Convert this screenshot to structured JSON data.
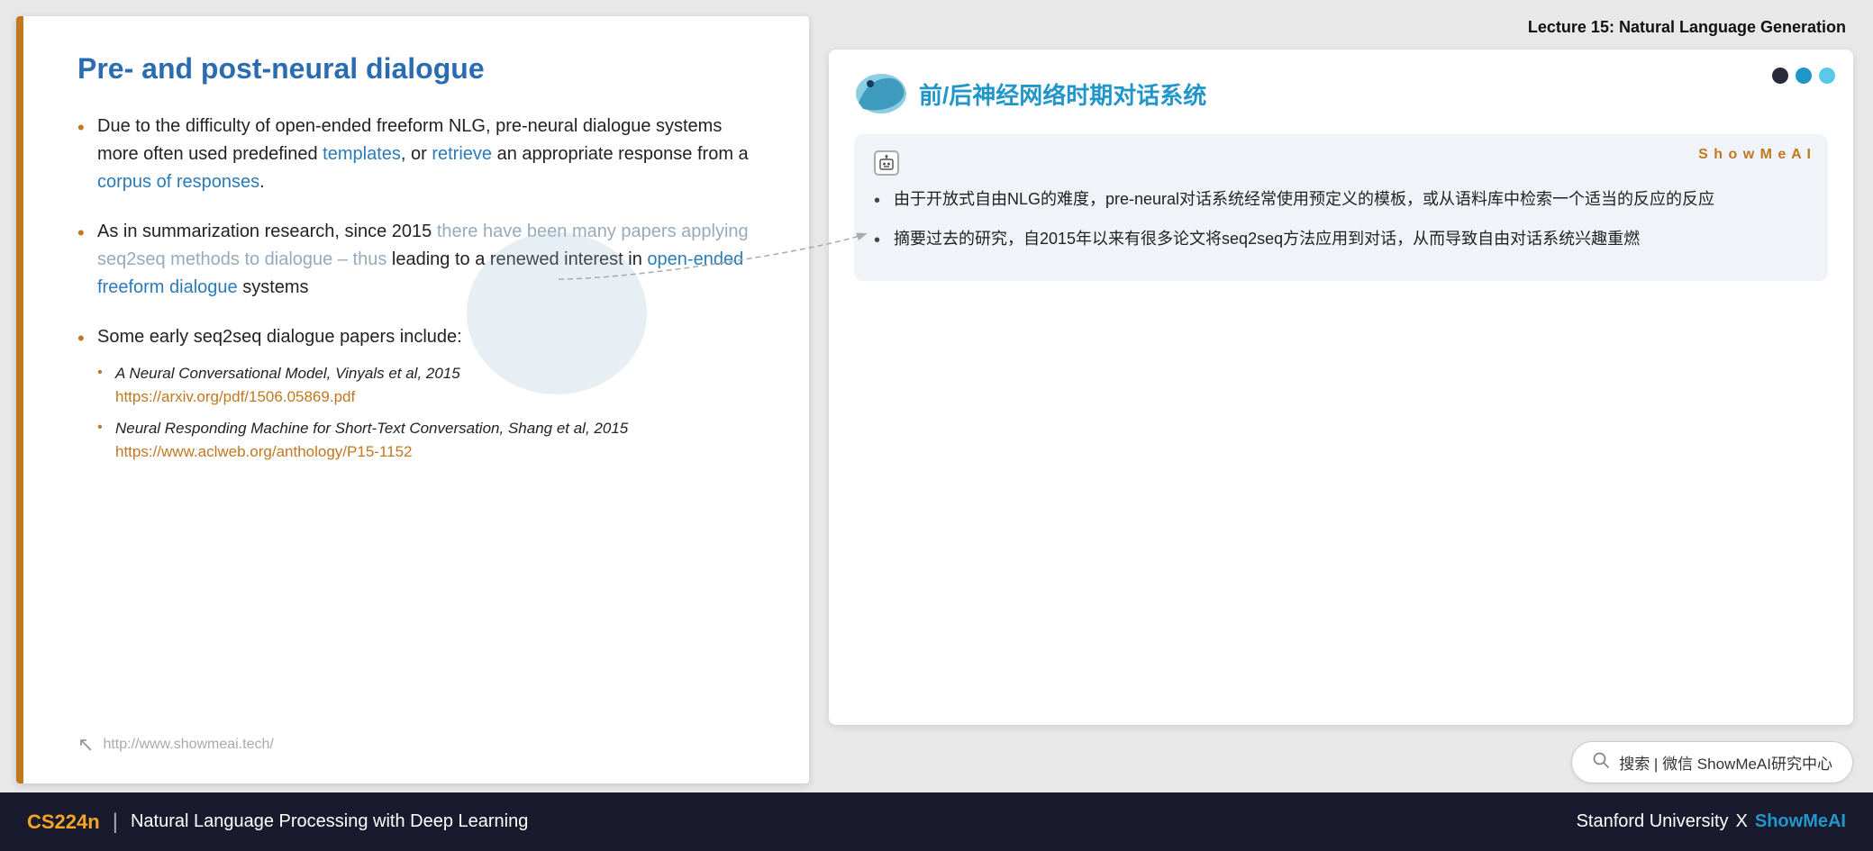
{
  "lecture": {
    "header": "Lecture 15: Natural Language Generation"
  },
  "left_slide": {
    "title": "Pre- and post-neural dialogue",
    "bullet1": {
      "text_before": "Due to the difficulty of open-ended freeform NLG, pre-neural dialogue systems more often used predefined ",
      "link1_text": "templates",
      "text_middle": ", or ",
      "link2_text": "retrieve",
      "text_after": " an appropriate response from a ",
      "link3_text": "corpus of responses",
      "text_end": "."
    },
    "bullet2": {
      "text_before": "As in summarization research, since 2015 ",
      "text_muted": "there have been many papers applying seq2seq methods to dialogue – thus",
      "text_after": " leading to a renewed interest in ",
      "link_text": "open-ended freeform dialogue",
      "text_end": " systems"
    },
    "bullet3": {
      "text": "Some early seq2seq dialogue papers include:",
      "sub1": {
        "text": "A Neural Conversational Model, Vinyals et al, 2015",
        "link": "https://arxiv.org/pdf/1506.05869.pdf"
      },
      "sub2": {
        "text": "Neural Responding Machine for Short-Text Conversation, Shang et al, 2015",
        "link": "https://www.aclweb.org/anthology/P15-1152"
      }
    },
    "footer_url": "http://www.showmeai.tech/"
  },
  "right_panel": {
    "chinese_title": "前/后神经网络时期对话系统",
    "showmeai_label": "S h o w M e A I",
    "dots": [
      "dark",
      "blue",
      "light"
    ],
    "annotation": {
      "bullet1": "由于开放式自由NLG的难度，pre-neural对话系统经常使用预定义的模板，或从语料库中检索一个适当的反应的反应",
      "bullet2": "摘要过去的研究，自2015年以来有很多论文将seq2seq方法应用到对话，从而导致自由对话系统兴趣重燃"
    },
    "search_bar": {
      "icon": "🔍",
      "text": "搜索 | 微信 ShowMeAI研究中心"
    }
  },
  "footer": {
    "course": "CS224n",
    "divider": "|",
    "subtitle": "Natural Language Processing with Deep Learning",
    "university": "Stanford University",
    "x": "X",
    "brand": "ShowMeAI"
  }
}
